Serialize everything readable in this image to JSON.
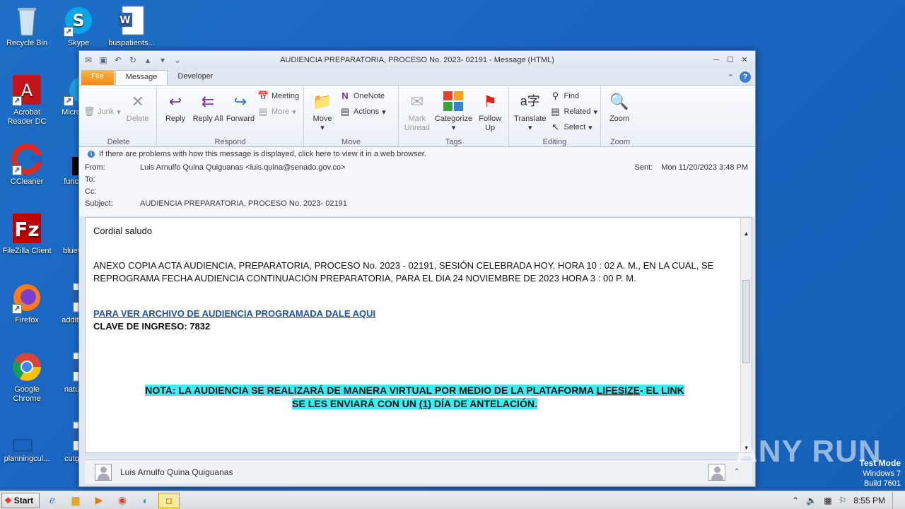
{
  "desktop": {
    "icons": [
      {
        "label": "Recycle Bin"
      },
      {
        "label": "Skype"
      },
      {
        "label": "buspatients..."
      },
      {
        "label": "Acrobat Reader DC"
      },
      {
        "label": "Microso..."
      },
      {
        "label": "CCleaner"
      },
      {
        "label": "functio..."
      },
      {
        "label": "FileZilla Client"
      },
      {
        "label": "bluewe..."
      },
      {
        "label": "Firefox"
      },
      {
        "label": "addition..."
      },
      {
        "label": "Google Chrome"
      },
      {
        "label": "nature..."
      },
      {
        "label": "planningcul..."
      },
      {
        "label": "cutgro..."
      }
    ]
  },
  "window": {
    "title": "AUDIENCIA PREPARATORIA, PROCESO No. 2023- 02191 - Message (HTML)"
  },
  "tabs": {
    "file": "File",
    "message": "Message",
    "developer": "Developer"
  },
  "ribbon": {
    "delete_group": {
      "label": "Delete",
      "junk": "Junk",
      "delete": "Delete"
    },
    "respond_group": {
      "label": "Respond",
      "reply": "Reply",
      "reply_all": "Reply All",
      "forward": "Forward",
      "meeting": "Meeting",
      "more": "More"
    },
    "move_group": {
      "label": "Move",
      "move": "Move",
      "onenote": "OneNote",
      "actions": "Actions"
    },
    "tags_group": {
      "label": "Tags",
      "mark_unread": "Mark Unread",
      "categorize": "Categorize",
      "follow_up": "Follow Up"
    },
    "editing_group": {
      "label": "Editing",
      "translate": "Translate",
      "find": "Find",
      "related": "Related",
      "select": "Select"
    },
    "zoom_group": {
      "label": "Zoom",
      "zoom": "Zoom"
    }
  },
  "infobar": {
    "text": "If there are problems with how this message is displayed, click here to view it in a web browser."
  },
  "header": {
    "from_label": "From:",
    "from_value": "Luis Arnulfo Quina Quiguanas <luis.quina@senado.gov.co>",
    "to_label": "To:",
    "cc_label": "Cc:",
    "subject_label": "Subject:",
    "subject_value": "AUDIENCIA PREPARATORIA, PROCESO No. 2023- 02191",
    "sent_label": "Sent:",
    "sent_value": "Mon 11/20/2023 3:48 PM"
  },
  "body": {
    "greeting": "Cordial saludo",
    "paragraph": "ANEXO COPIA ACTA AUDIENCIA, PREPARATORIA, PROCESO No. 2023 - 02191, SESIÓN CELEBRADA HOY, HORA 10 : 02 A. M., EN LA CUAL, SE REPROGRAMA FECHA AUDIENCIA CONTINUACIÓN PREPARATORIA, PARA EL DIA 24 NOVIEMBRE DE 2023 HORA 3 : 00 P. M.",
    "link": "PARA VER ARCHIVO DE AUDIENCIA PROGRAMADA DALE AQUI",
    "password": "CLAVE DE INGRESO: 7832",
    "note_part1": "NOTA: LA AUDIENCIA SE REALIZARÁ DE MANERA VIRTUAL POR MEDIO DE LA PLATAFORMA ",
    "note_lifesize": "LIFESIZE",
    "note_part2": "- EL LINK",
    "note_line2a": "SE LES ENVIARÁ CON UN ",
    "note_one": "(1)",
    "note_line2b": " DÍA DE ANTELACIÓN."
  },
  "people_pane": {
    "name": "Luis Arnulfo Quina Quiguanas"
  },
  "taskbar": {
    "start": "Start",
    "time": "8:55 PM"
  },
  "watermark": {
    "text": "ANY RUN"
  },
  "testmode": {
    "line1": "Test Mode",
    "line2": "Windows 7",
    "line3": "Build 7601"
  }
}
